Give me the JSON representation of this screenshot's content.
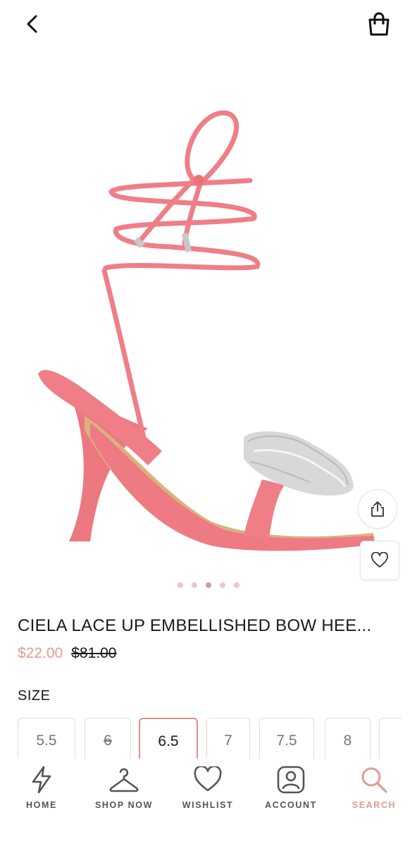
{
  "header": {
    "back_icon": "chevron-left-icon",
    "bag_icon": "shopping-bag-icon"
  },
  "product": {
    "title": "CIELA LACE UP EMBELLISHED BOW HEE...",
    "sale_price": "$22.00",
    "original_price": "$81.00",
    "image_count": 5,
    "active_image_index": 2
  },
  "actions": {
    "share_icon": "share-icon",
    "wishlist_icon": "heart-icon"
  },
  "size_section": {
    "label": "SIZE",
    "options": [
      {
        "label": "5.5",
        "sold_out": false,
        "selected": false
      },
      {
        "label": "6",
        "sold_out": true,
        "selected": false
      },
      {
        "label": "6.5",
        "sold_out": false,
        "selected": true
      },
      {
        "label": "7",
        "sold_out": false,
        "selected": false
      },
      {
        "label": "7.5",
        "sold_out": false,
        "selected": false
      },
      {
        "label": "8",
        "sold_out": false,
        "selected": false
      }
    ]
  },
  "bottom_nav": [
    {
      "label": "HOME",
      "icon": "lightning-icon",
      "active": false
    },
    {
      "label": "SHOP NOW",
      "icon": "hanger-icon",
      "active": false
    },
    {
      "label": "WISHLIST",
      "icon": "heart-icon",
      "active": false
    },
    {
      "label": "ACCOUNT",
      "icon": "account-icon",
      "active": false
    },
    {
      "label": "SEARCH",
      "icon": "search-icon",
      "active": true
    }
  ],
  "colors": {
    "accent": "#e09b94",
    "shoe_pink": "#ef7b85",
    "selected_border": "#e28e88"
  }
}
